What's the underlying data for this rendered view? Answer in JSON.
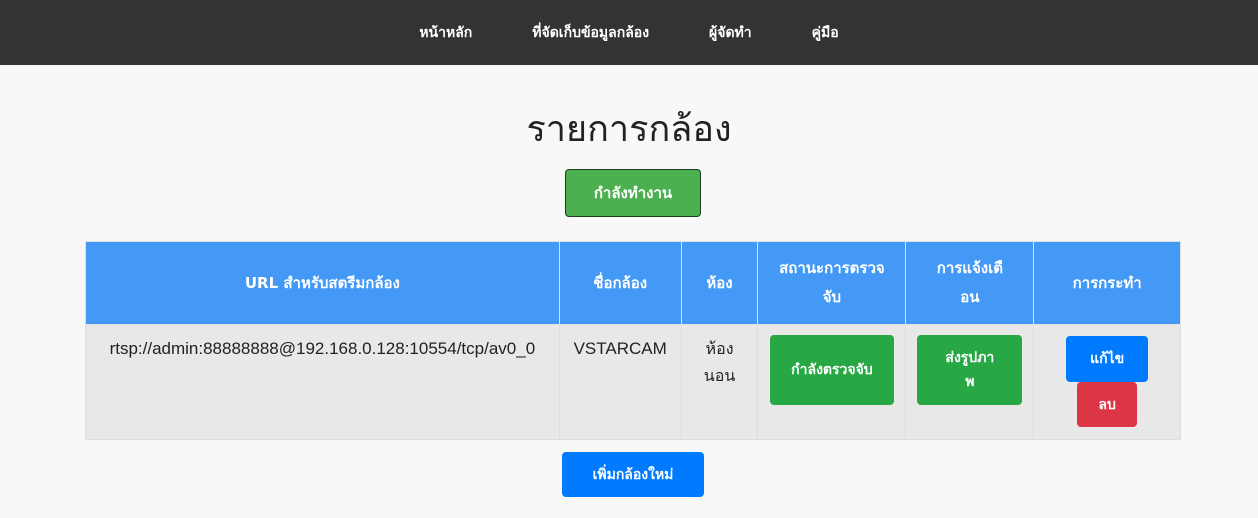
{
  "nav": {
    "items": [
      {
        "label": "หน้าหลัก"
      },
      {
        "label": "ที่จัดเก็บข้อมูลกล้อง"
      },
      {
        "label": "ผู้จัดทำ"
      },
      {
        "label": "คู่มือ"
      }
    ]
  },
  "main": {
    "title": "รายการกล้อง",
    "status_button_label": "กำลังทำงาน",
    "add_button_label": "เพิ่มกล้องใหม่"
  },
  "table": {
    "headers": [
      "URL สำหรับสตรีมกล้อง",
      "ชื่อกล้อง",
      "ห้อง",
      "สถานะการตรวจจับ",
      "การแจ้งเตือน",
      "การกระทำ"
    ],
    "rows": [
      {
        "url": "rtsp://admin:88888888@192.168.0.128:10554/tcp/av0_0",
        "name": "VSTARCAM",
        "room": "ห้องนอน",
        "detection_label": "กำลังตรวจจับ",
        "notify_label": "ส่งรูปภาพ",
        "edit_label": "แก้ไข",
        "delete_label": "ลบ"
      }
    ]
  },
  "colors": {
    "navbar": "#333333",
    "header": "#4399f5",
    "green": "#28a745",
    "status_green": "#4caf50",
    "blue": "#007bff",
    "red": "#dc3545"
  }
}
